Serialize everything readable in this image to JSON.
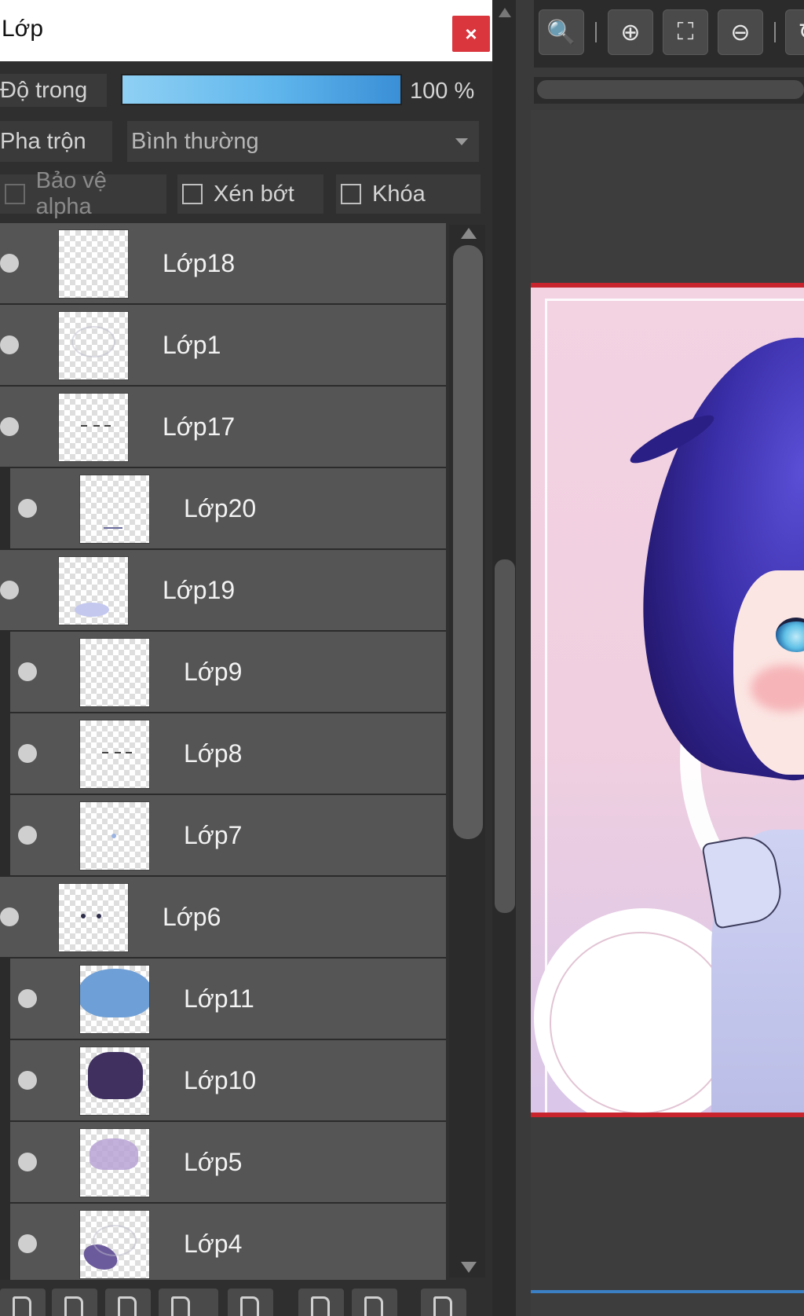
{
  "panel": {
    "title": "Lớp",
    "close_label": "×",
    "opacity": {
      "label": "Độ trong",
      "value": "100 %",
      "fraction": 1.0
    },
    "blend": {
      "label": "Pha trộn",
      "selected": "Bình thường"
    },
    "checks": {
      "protect_alpha": "Bảo vệ alpha",
      "clipping": "Xén bớt",
      "lock": "Khóa"
    }
  },
  "layers": [
    {
      "name": "Lớp18",
      "child": false,
      "thumb": "empty"
    },
    {
      "name": "Lớp1",
      "child": false,
      "thumb": "sketch"
    },
    {
      "name": "Lớp17",
      "child": false,
      "thumb": "dash"
    },
    {
      "name": "Lớp20",
      "child": true,
      "thumb": "mouth"
    },
    {
      "name": "Lớp19",
      "child": false,
      "thumb": "collar"
    },
    {
      "name": "Lớp9",
      "child": true,
      "thumb": "empty"
    },
    {
      "name": "Lớp8",
      "child": true,
      "thumb": "dash"
    },
    {
      "name": "Lớp7",
      "child": true,
      "thumb": "dot"
    },
    {
      "name": "Lớp6",
      "child": false,
      "thumb": "dots"
    },
    {
      "name": "Lớp11",
      "child": true,
      "thumb": "blob"
    },
    {
      "name": "Lớp10",
      "child": true,
      "thumb": "hair"
    },
    {
      "name": "Lớp5",
      "child": true,
      "thumb": "hair2"
    },
    {
      "name": "Lớp4",
      "child": true,
      "thumb": "body"
    }
  ],
  "canvas_toolbar": {
    "buttons": [
      "zoom-actual-icon",
      "zoom-in-icon",
      "fit-screen-icon",
      "zoom-out-icon",
      "rotate-icon"
    ]
  },
  "colors": {
    "close_button": "#d9363e",
    "opacity_fill": "#5fb6ec",
    "canvas_border": "#c8242e",
    "hair": "#3a2ea8"
  }
}
